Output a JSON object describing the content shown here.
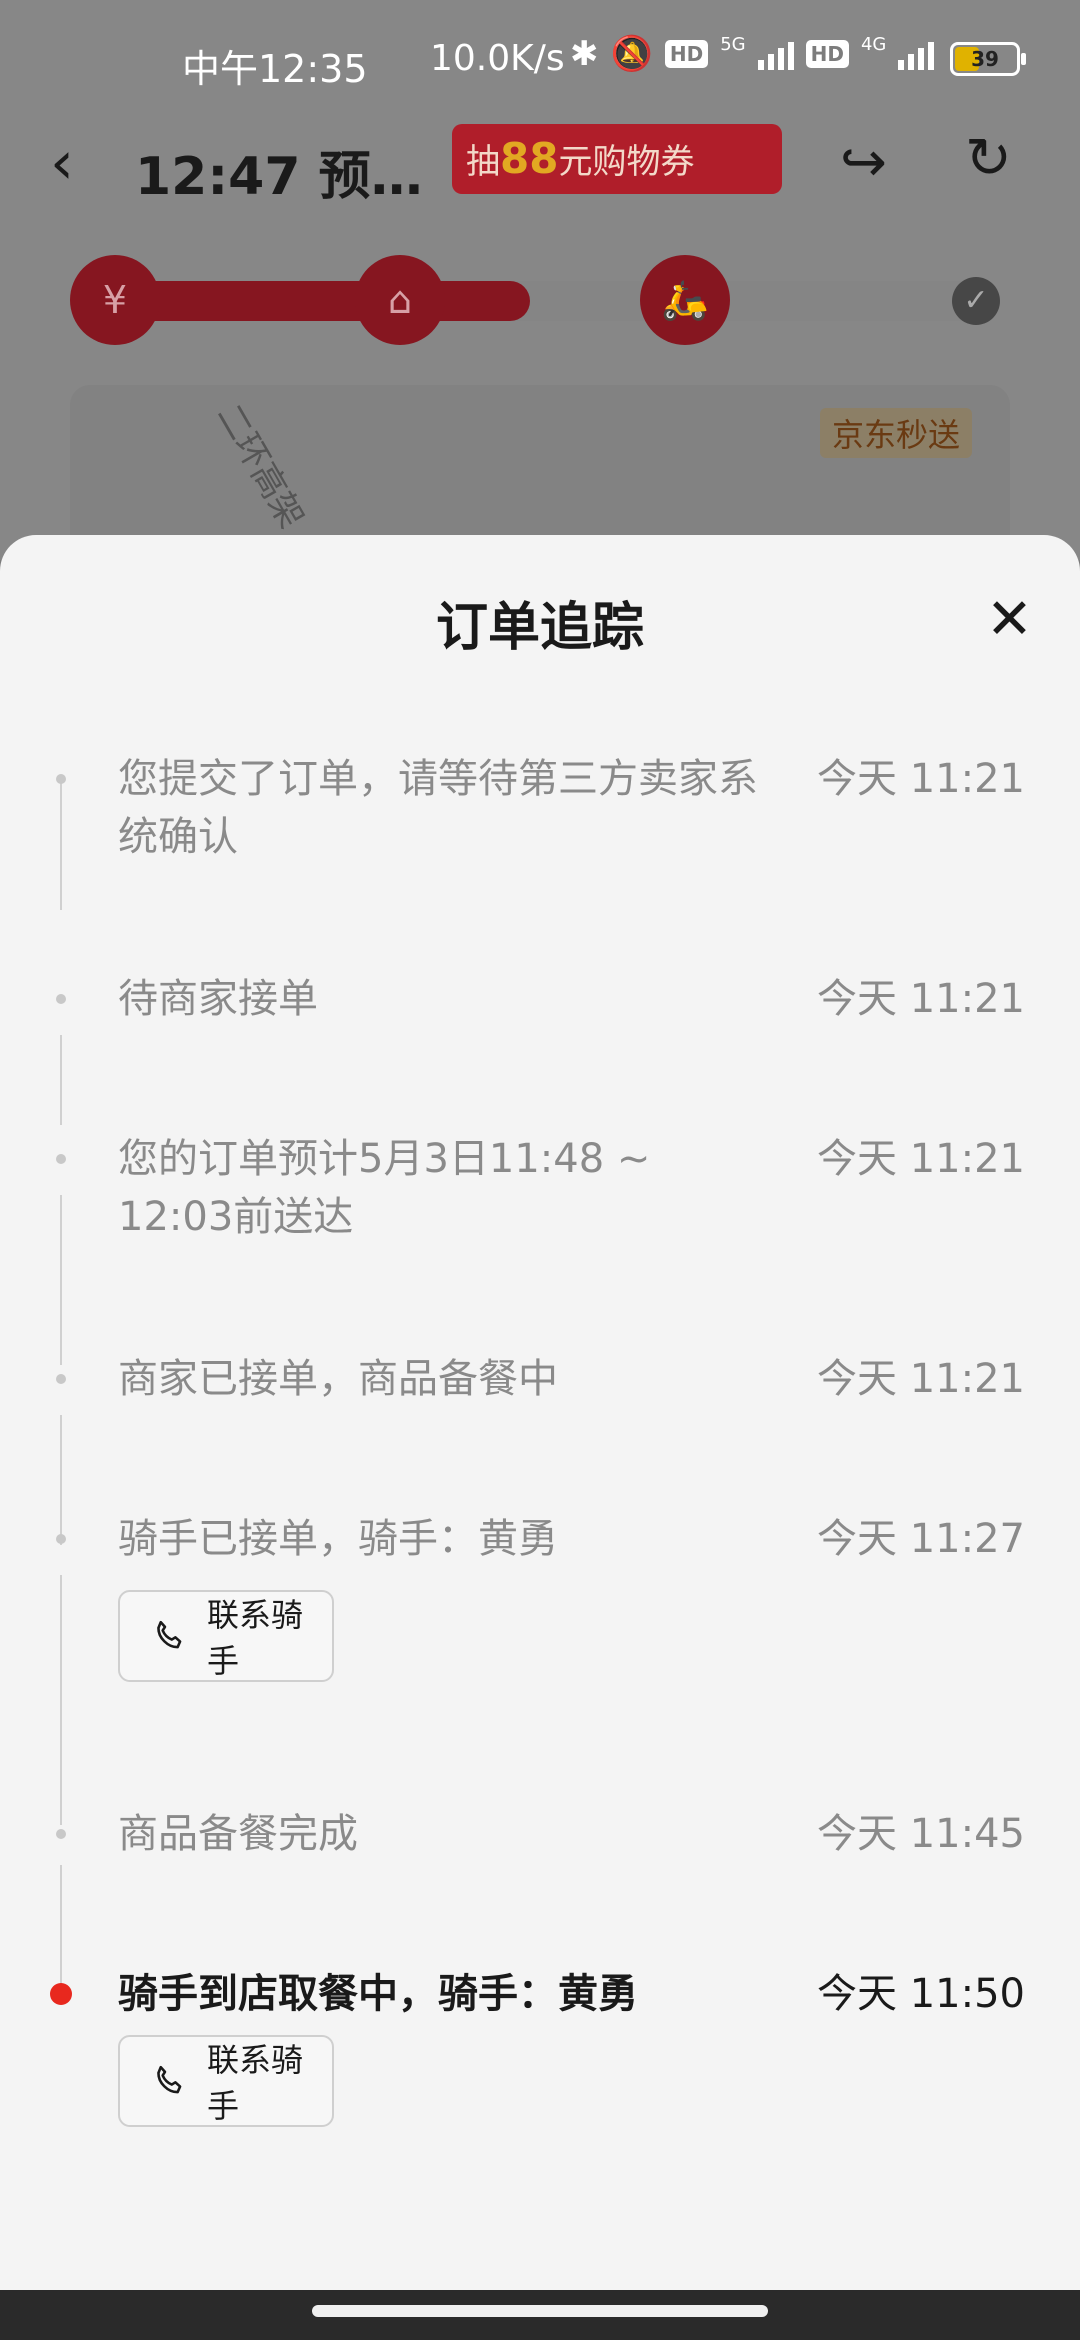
{
  "status_bar": {
    "time": "中午12:35",
    "net_speed": "10.0K/s",
    "hd1": "HD",
    "sig1": "5G",
    "hd2": "HD",
    "sig2": "4G",
    "battery": "39"
  },
  "header": {
    "title": "12:47 预…",
    "promo_pre": "抽",
    "promo_num": "88",
    "promo_post": "元购物券"
  },
  "map": {
    "tag": "京东秒送",
    "road": "二环高架"
  },
  "sheet": {
    "title": "订单追踪",
    "events": [
      {
        "text": "您提交了订单，请等待第三方卖家系统确认",
        "time": "今天 11:21"
      },
      {
        "text": "待商家接单",
        "time": "今天 11:21"
      },
      {
        "text": "您的订单预计5月3日11:48 ~ 12:03前送达",
        "time": "今天 11:21"
      },
      {
        "text": "商家已接单，商品备餐中",
        "time": "今天 11:21"
      },
      {
        "text": "骑手已接单，骑手：黄勇",
        "time": "今天 11:27",
        "button": "联系骑手"
      },
      {
        "text": "商品备餐完成",
        "time": "今天 11:45"
      },
      {
        "text": "骑手到店取餐中，骑手：黄勇",
        "time": "今天 11:50",
        "button": "联系骑手"
      }
    ]
  },
  "icons": {
    "back": "back-arrow-icon",
    "share": "share-icon",
    "refresh": "refresh-icon",
    "close": "close-icon",
    "phone": "phone-icon"
  },
  "colors": {
    "accent_red": "#e8281e",
    "progress_red": "#861620"
  }
}
